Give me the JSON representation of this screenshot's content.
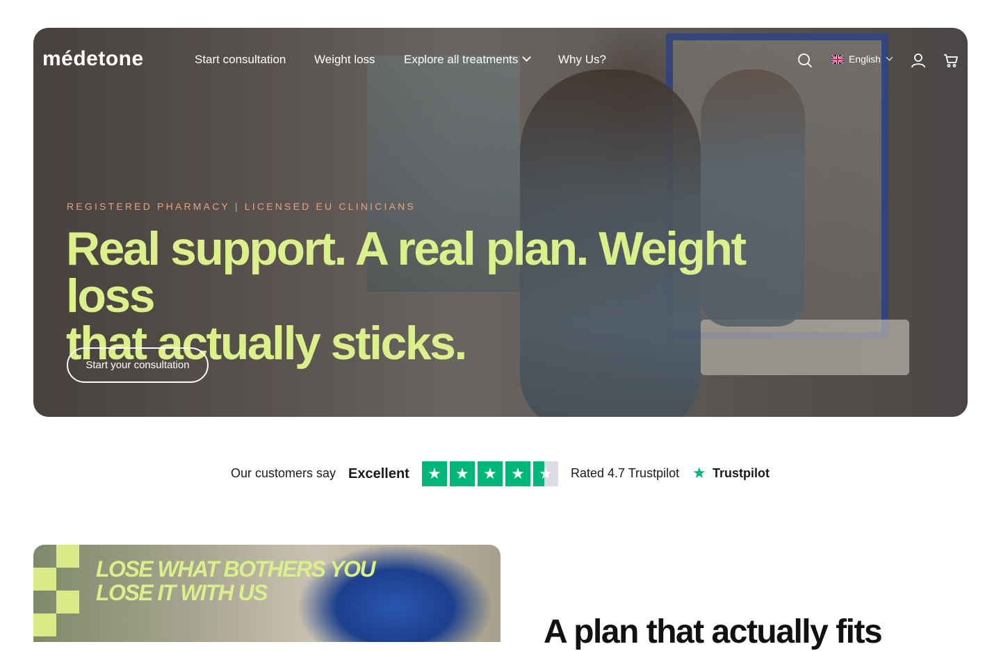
{
  "brand": {
    "logo_text": "médetone"
  },
  "nav": {
    "links": [
      {
        "label": "Start consultation"
      },
      {
        "label": "Weight loss"
      },
      {
        "label": "Explore all treatments"
      },
      {
        "label": "Why Us?"
      }
    ],
    "language": "English",
    "icons": [
      "search-icon",
      "flag-uk-icon",
      "account-icon",
      "cart-icon"
    ]
  },
  "hero": {
    "eyebrow": "REGISTERED PHARMACY | LICENSED EU CLINICIANS",
    "headline_line1": "Real support. A real plan. Weight loss",
    "headline_line2": "that actually sticks.",
    "cta_label": "Start your consultation"
  },
  "trustpilot": {
    "intro": "Our customers say",
    "rating_word": "Excellent",
    "stars": 4.5,
    "rated_text": "Rated 4.7 Trustpilot",
    "brand": "Trustpilot",
    "color": "#00b67a"
  },
  "promo": {
    "line1": "LOSE WHAT BOTHERS YOU",
    "line2": "LOSE IT WITH US"
  },
  "section": {
    "title_partial": "A plan that actually fits"
  },
  "colors": {
    "accent_lime": "#dbef8a",
    "eyebrow_orange": "#e6a37c",
    "trustpilot_green": "#00b67a"
  }
}
